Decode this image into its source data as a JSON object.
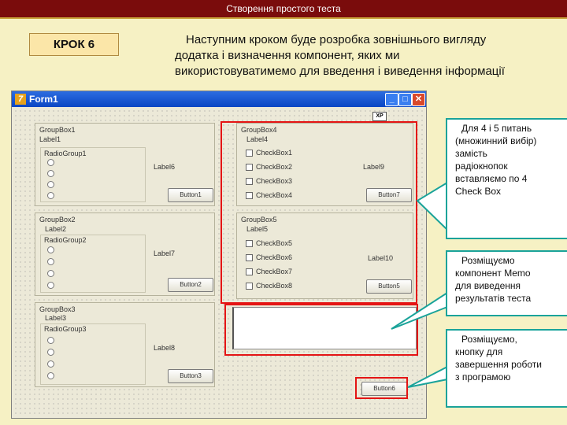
{
  "header": {
    "title": "Створення простого теста"
  },
  "step_label": "КРОК 6",
  "intro_lines": [
    "Наступним кроком буде розробка зовнішнього вигляду",
    "додатка і визначення компонент, яких ми",
    "використовуватимемо для введення і виведення інформації"
  ],
  "window": {
    "title": "Form1",
    "xp_badge": "XP",
    "group1": {
      "caption": "GroupBox1",
      "label": "Label1",
      "radio_caption": "RadioGroup1",
      "side_label": "Label6",
      "button": "Button1"
    },
    "group2": {
      "caption": "GroupBox2",
      "label": "Label2",
      "radio_caption": "RadioGroup2",
      "side_label": "Label7",
      "button": "Button2"
    },
    "group3": {
      "caption": "GroupBox3",
      "label": "Label3",
      "radio_caption": "RadioGroup3",
      "side_label": "Label8",
      "button": "Button3"
    },
    "group4": {
      "caption": "GroupBox4",
      "label": "Label4",
      "checks": [
        "CheckBox1",
        "CheckBox2",
        "CheckBox3",
        "CheckBox4"
      ],
      "side_label": "Label9",
      "button": "Button7"
    },
    "group5": {
      "caption": "GroupBox5",
      "label": "Label5",
      "checks": [
        "CheckBox5",
        "CheckBox6",
        "CheckBox7",
        "CheckBox8"
      ],
      "side_label": "Label10",
      "button": "Button5"
    },
    "finish_button": "Button6"
  },
  "callouts": {
    "checkbox_note": [
      "Для 4 і 5 питань",
      "(множинний вибір)",
      "замість",
      "радіокнопок",
      "вставляємо по 4",
      "Check Box"
    ],
    "memo_note": [
      "Розміщуємо",
      "компонент Memo",
      "для виведення",
      "результатів теста"
    ],
    "button_note": [
      "Розміщуємо,",
      "кнопку для",
      "завершення роботи",
      "з програмою"
    ]
  },
  "colors": {
    "header_bg": "#7a0c0c",
    "highlight": "#e41414",
    "callout_border": "#1aa39a",
    "slide_bg": "#f6f1c4"
  }
}
